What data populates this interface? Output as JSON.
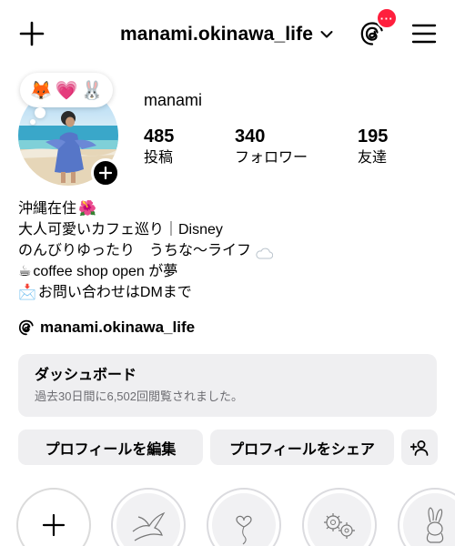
{
  "header": {
    "username": "manami.okinawa_life",
    "notification_badge": "···"
  },
  "profile": {
    "note_emojis": [
      "🦊",
      "💗",
      "🐰"
    ],
    "display_name": "manami",
    "stats": [
      {
        "value": "485",
        "label": "投稿"
      },
      {
        "value": "340",
        "label": "フォロワー"
      },
      {
        "value": "195",
        "label": "友達"
      }
    ]
  },
  "bio": {
    "line1": {
      "text": "沖縄在住",
      "emoji": "🌺"
    },
    "line2": {
      "text": "大人可愛いカフェ巡り｜Disney"
    },
    "line3": {
      "text": "のんびりゆったり　うちな〜ライフ",
      "icon": "cloud-icon"
    },
    "line4": {
      "emoji": "☕",
      "text": "coffee shop open が夢"
    },
    "line5": {
      "emoji": "📩",
      "text": "お問い合わせはDMまで"
    }
  },
  "threads_link": {
    "text": "manami.okinawa_life"
  },
  "dashboard": {
    "title": "ダッシュボード",
    "subtitle": "過去30日間に6,502回閲覧されました。"
  },
  "actions": {
    "edit_label": "プロフィールを編集",
    "share_label": "プロフィールをシェア"
  },
  "highlights": [
    {
      "icon": "plus-icon"
    },
    {
      "icon": "dove-icon"
    },
    {
      "icon": "heart-balloon-icon"
    },
    {
      "icon": "gears-icon"
    },
    {
      "icon": "bunny-icon"
    }
  ],
  "colors": {
    "badge": "#ff1f3d",
    "button_bg": "#efeff1",
    "secondary_text": "#6d6d72"
  }
}
